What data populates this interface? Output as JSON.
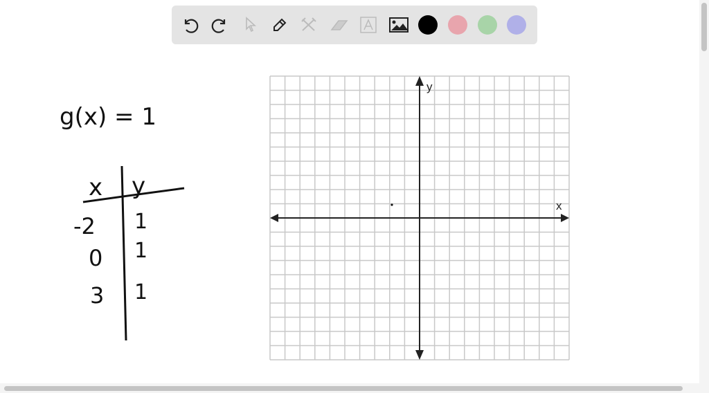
{
  "toolbar": {
    "tools": [
      "undo-icon",
      "redo-icon",
      "select-icon",
      "pen-icon",
      "tools-icon",
      "eraser-icon",
      "text-icon",
      "image-icon"
    ],
    "colors": {
      "black": "#000000",
      "red": "#e8a5ad",
      "green": "#a8d4a8",
      "blue": "#b0b0e8"
    }
  },
  "work": {
    "function": "g(x) = 1",
    "table": {
      "headers": [
        "x",
        "y"
      ],
      "rows": [
        [
          "-2",
          "1"
        ],
        [
          "0",
          "1"
        ],
        [
          "3",
          "1"
        ]
      ]
    }
  },
  "graph": {
    "x_label": "x",
    "y_label": "y"
  }
}
